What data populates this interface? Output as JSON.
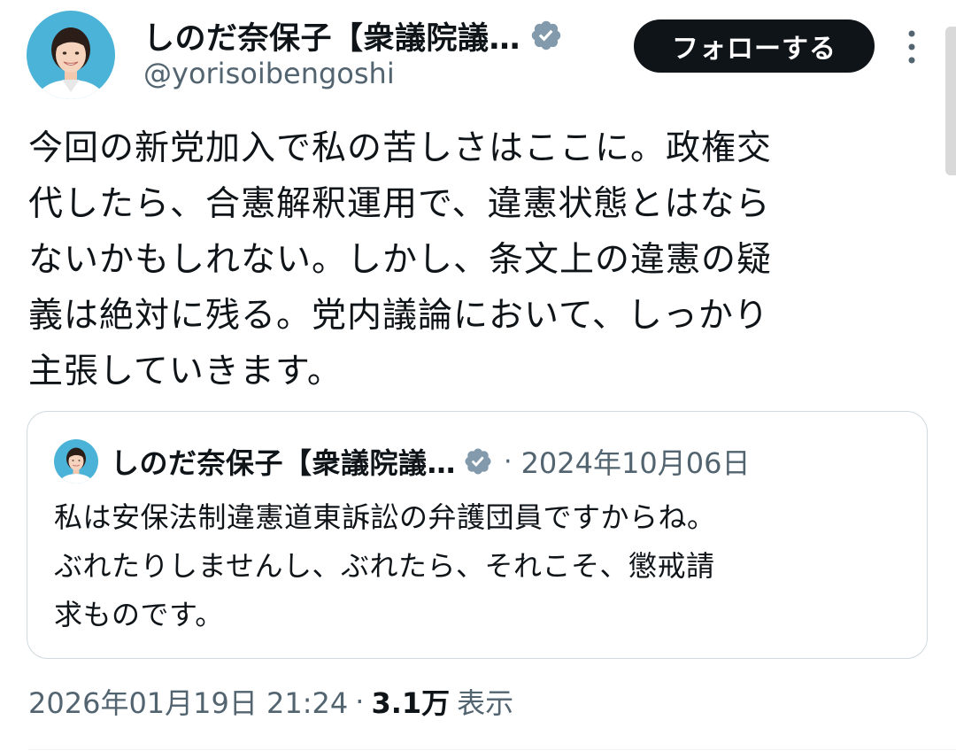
{
  "author": {
    "display_name": "しのだ奈保子【衆議院議…",
    "handle": "@yorisoibengoshi",
    "verified_badge": "verified-badge-icon",
    "avatar": "profile-photo"
  },
  "follow_button": {
    "label": "フォローする"
  },
  "more_button": {
    "icon": "more-vertical-icon"
  },
  "tweet": {
    "lines": [
      "今回の新党加入で私の苦しさはここに。政権交",
      "代したら、合憲解釈運用で、違憲状態とはなら",
      "ないかもしれない。しかし、条文上の違憲の疑",
      "義は絶対に残る。党内議論において、しっかり",
      "主張していきます。"
    ]
  },
  "quote": {
    "display_name": "しのだ奈保子【衆議院議…",
    "separator": "·",
    "date": "2024年10月06日",
    "lines": [
      "私は安保法制違憲道東訴訟の弁護団員ですからね。",
      "ぶれたりしませんし、ぶれたら、それこそ、懲戒請",
      "求ものです。"
    ]
  },
  "meta": {
    "timestamp": "2026年01月19日 21:24",
    "separator": "·",
    "views_count": "3.1万",
    "views_label": "表示"
  },
  "colors": {
    "text": "#0f1419",
    "secondary": "#536471",
    "border": "#cfd9de",
    "badge": "#829aab",
    "avatar_bg": "#4cb3d8"
  }
}
